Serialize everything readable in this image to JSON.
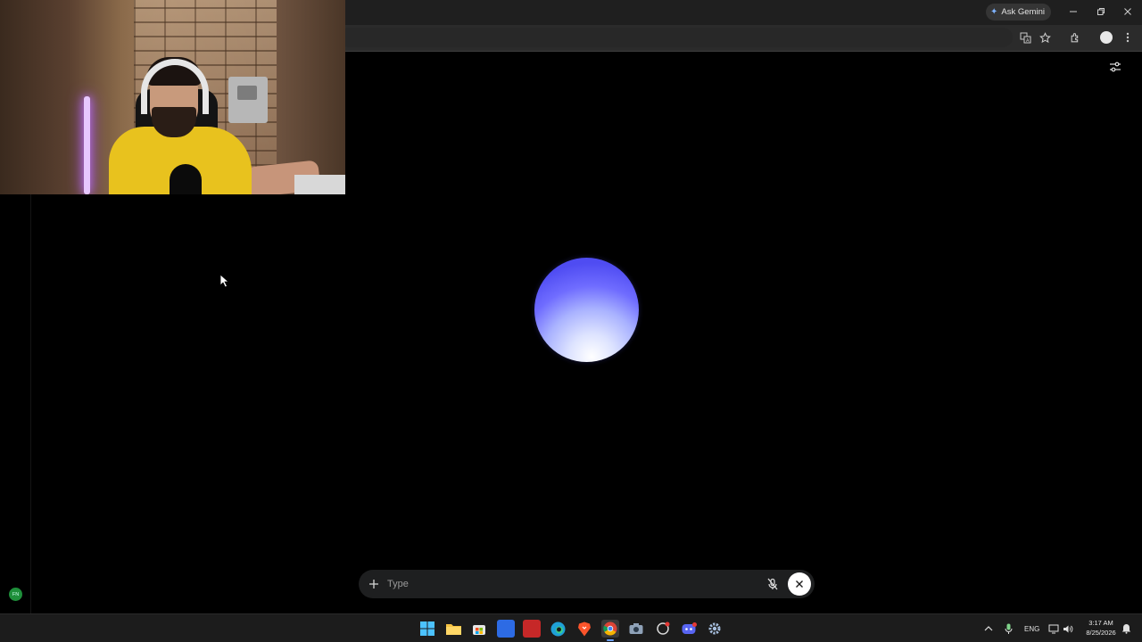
{
  "browser": {
    "ask_gemini_label": "Ask Gemini",
    "icons": {
      "translate": "translate-icon",
      "bookmark": "star-icon",
      "extensions": "extensions-icon",
      "profile": "profile-icon",
      "menu": "more-vert-icon",
      "minimize": "minimize-icon",
      "restore": "restore-icon",
      "close": "close-icon"
    }
  },
  "live_session": {
    "settings_icon": "sliders-icon",
    "orb_colors": [
      "#4f4cf2",
      "#a9b2ff",
      "#ffffff"
    ],
    "input": {
      "placeholder": "Type",
      "add_icon": "plus-icon",
      "mic_icon": "mic-off-icon",
      "end_icon": "close-icon"
    }
  },
  "sidebar": {
    "badge_label": "FN"
  },
  "taskbar": {
    "apps": [
      {
        "name": "start",
        "icon": "windows-icon"
      },
      {
        "name": "file-explorer",
        "icon": "folder-icon"
      },
      {
        "name": "store",
        "icon": "store-icon"
      },
      {
        "name": "app-3",
        "icon": "app-icon"
      },
      {
        "name": "app-voice",
        "icon": "app-icon"
      },
      {
        "name": "edge",
        "icon": "edge-icon"
      },
      {
        "name": "brave",
        "icon": "brave-icon"
      },
      {
        "name": "chrome",
        "icon": "chrome-icon",
        "active": true
      },
      {
        "name": "camera",
        "icon": "camera-icon"
      },
      {
        "name": "app-swirl",
        "icon": "app-icon"
      },
      {
        "name": "discord",
        "icon": "discord-icon"
      },
      {
        "name": "settings",
        "icon": "gear-icon"
      }
    ],
    "tray": {
      "language": "ENG",
      "time": "3:17 AM",
      "date": "8/25/2026"
    }
  },
  "accent_colors": {
    "chrome_bg": "#1f1f1f",
    "page_bg": "#000000",
    "input_bg": "#1e1f20",
    "taskbar_bg": "#1c1c1c"
  }
}
